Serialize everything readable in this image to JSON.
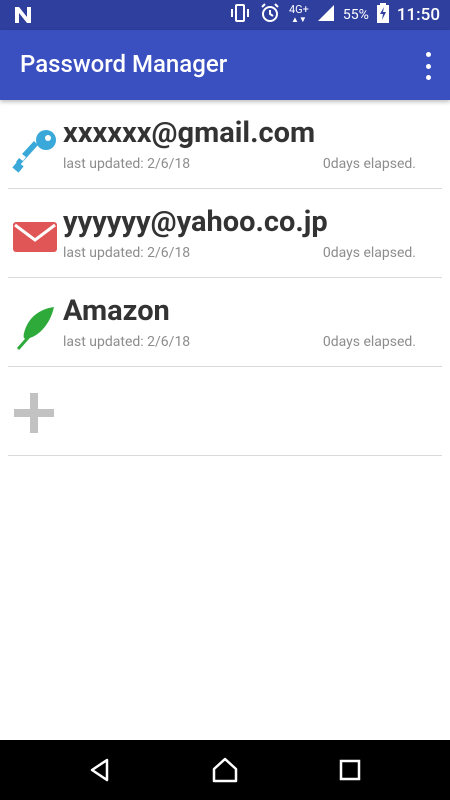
{
  "statusbar": {
    "network": "4G+",
    "battery_percent": "55%",
    "time": "11:50"
  },
  "appbar": {
    "title": "Password Manager",
    "overflow_icon": "more-vert-icon"
  },
  "entries": [
    {
      "icon": "key-icon",
      "name": "xxxxxx@gmail.com",
      "updated": "last updated: 2/6/18",
      "elapsed": "0days elapsed.",
      "color": "#3aa8d8"
    },
    {
      "icon": "mail-icon",
      "name": "yyyyyy@yahoo.co.jp",
      "updated": "last updated: 2/6/18",
      "elapsed": "0days elapsed.",
      "color": "#e05555"
    },
    {
      "icon": "feather-icon",
      "name": "Amazon",
      "updated": "last updated: 2/6/18",
      "elapsed": "0days elapsed.",
      "color": "#2eaa3a"
    }
  ],
  "add_icon": "plus-icon",
  "navbar": {
    "back_icon": "back-icon",
    "home_icon": "home-icon",
    "recents_icon": "recents-icon"
  },
  "colors": {
    "statusbar": "#2f3f9e",
    "appbar": "#3b50c0",
    "divider": "#d9d9d9"
  }
}
